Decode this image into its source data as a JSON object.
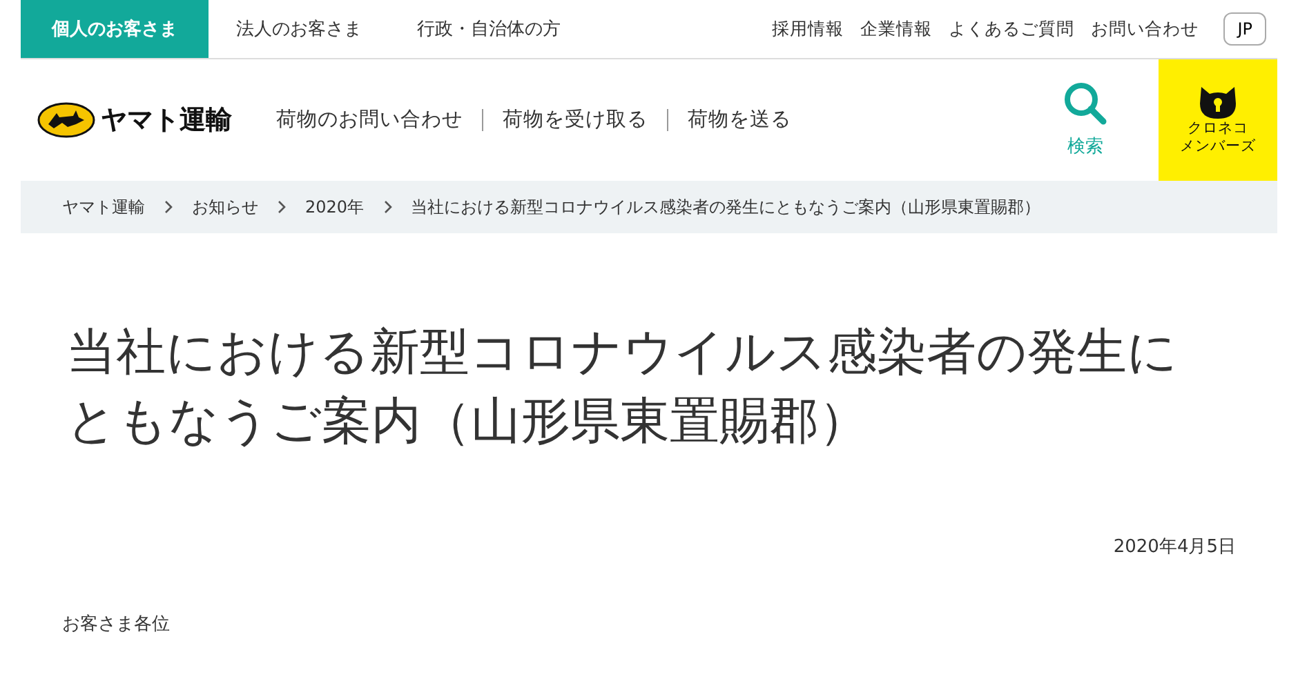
{
  "audience_tabs": [
    {
      "label": "個人のお客さま",
      "selected": true
    },
    {
      "label": "法人のお客さま",
      "selected": false
    },
    {
      "label": "行政・自治体の方",
      "selected": false
    }
  ],
  "utility_links": [
    "採用情報",
    "企業情報",
    "よくあるご質問",
    "お問い合わせ"
  ],
  "language_button": "JP",
  "header": {
    "logo_text": "ヤマト運輸",
    "nav": [
      "荷物のお問い合わせ",
      "荷物を受け取る",
      "荷物を送る"
    ],
    "search_label": "検索",
    "member_label": [
      "クロネコ",
      "メンバーズ"
    ]
  },
  "breadcrumb": [
    "ヤマト運輸",
    "お知らせ",
    "2020年",
    "当社における新型コロナウイルス感染者の発生にともなうご案内（山形県東置賜郡）"
  ],
  "article": {
    "title": "当社における新型コロナウイルス感染者の発生にともなうご案内（山形県東置賜郡）",
    "date": "2020年4月5日",
    "salutation": "お客さま各位"
  }
}
